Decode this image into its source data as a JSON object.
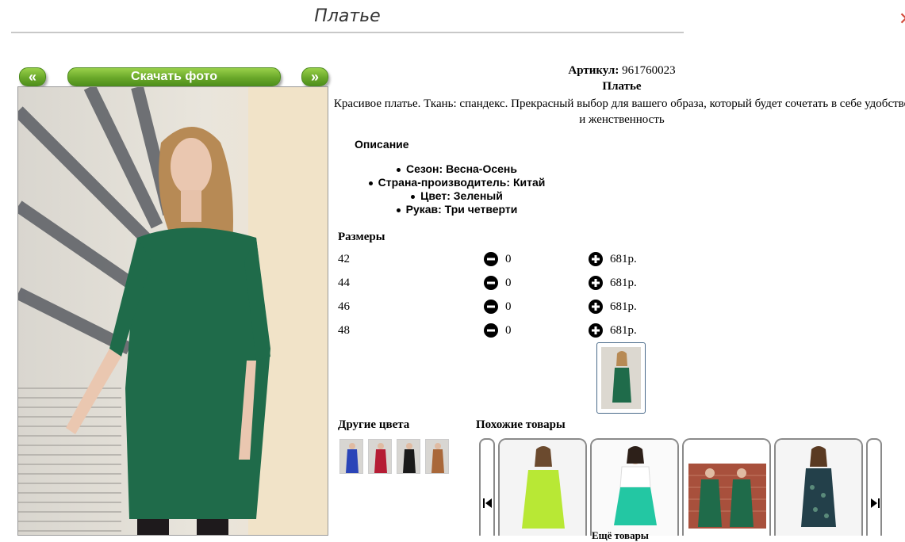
{
  "header": {
    "title": "Платье",
    "close_glyph": "✕"
  },
  "nav": {
    "prev_label": "«",
    "download_label": "Скачать фото",
    "next_label": "»"
  },
  "product": {
    "sku_label": "Артикул:",
    "sku_value": "961760023",
    "name": "Платье",
    "description": "Красивое платье. Ткань: спандекс. Прекрасный выбор для вашего образа, который будет сочетать в себе удобство и женственность",
    "description_heading": "Описание",
    "properties": [
      "Сезон: Весна-Осень",
      "Страна-производитель: Китай",
      "Цвет: Зеленый",
      "Рукав: Три четверти"
    ]
  },
  "sizes": {
    "title": "Размеры",
    "rows": [
      {
        "size": "42",
        "qty": "0",
        "price": "681р."
      },
      {
        "size": "44",
        "qty": "0",
        "price": "681р."
      },
      {
        "size": "46",
        "qty": "0",
        "price": "681р."
      },
      {
        "size": "48",
        "qty": "0",
        "price": "681р."
      }
    ]
  },
  "other_colors": {
    "title": "Другие цвета",
    "swatches": [
      "blue",
      "red",
      "black",
      "brown"
    ]
  },
  "similar": {
    "title": "Похожие товары",
    "more_label": "Ещё товары"
  },
  "icons": {
    "prev": "double-left-chevron-icon",
    "next": "double-right-chevron-icon",
    "minus": "minus-circle-icon",
    "plus": "plus-circle-icon",
    "carousel_prev": "skip-previous-icon",
    "carousel_next": "skip-next-icon"
  },
  "colors": {
    "accent_green": "#6aa82a",
    "dress_green": "#1f6b4a",
    "close_red": "#d24a3a"
  }
}
